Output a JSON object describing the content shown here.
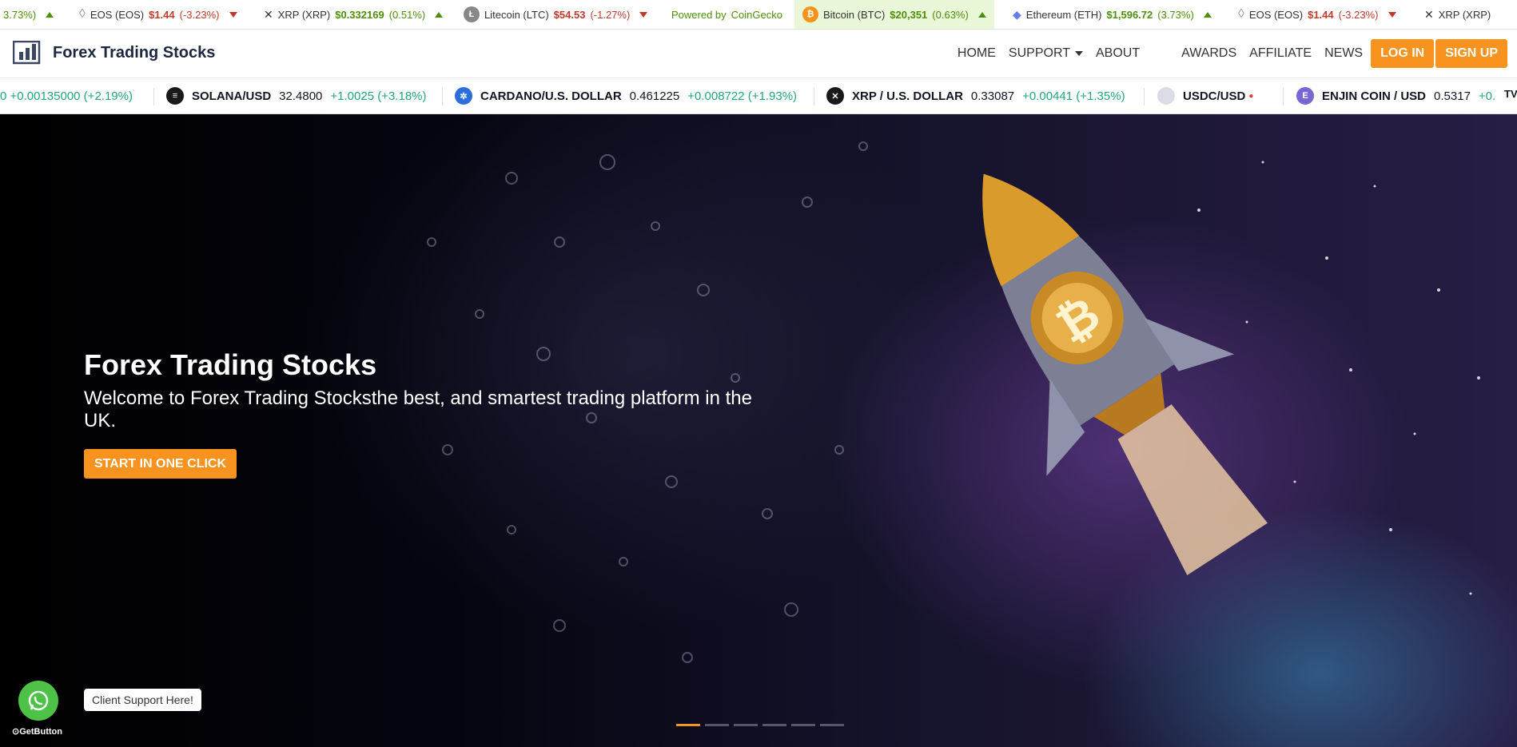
{
  "coin_ticker": {
    "items": [
      {
        "name": "",
        "price": "",
        "change": "3.73%)",
        "dir": "up",
        "icon_name": "",
        "icon_char": "",
        "icon_color": ""
      },
      {
        "name": "EOS (EOS)",
        "price": "$1.44",
        "change": "(-3.23%)",
        "dir": "down",
        "icon_name": "eos-icon",
        "icon_char": "◇",
        "icon_color": "#999999"
      },
      {
        "name": "XRP (XRP)",
        "price": "$0.332169",
        "change": "(0.51%)",
        "dir": "up",
        "icon_name": "xrp-icon",
        "icon_char": "✕",
        "icon_color": "#333333"
      },
      {
        "name": "Litecoin (LTC)",
        "price": "$54.53",
        "change": "(-1.27%)",
        "dir": "down",
        "icon_name": "litecoin-icon",
        "icon_char": "Ł",
        "icon_color": "#888888"
      },
      {
        "name": "Bitcoin (BTC)",
        "price": "$20,351",
        "change": "(0.63%)",
        "dir": "up",
        "icon_name": "bitcoin-icon",
        "icon_char": "₿",
        "icon_color": "#f7931a"
      },
      {
        "name": "Ethereum (ETH)",
        "price": "$1,596.72",
        "change": "(3.73%)",
        "dir": "up",
        "icon_name": "ethereum-icon",
        "icon_char": "◆",
        "icon_color": "#627eea"
      },
      {
        "name": "EOS (EOS)",
        "price": "$1.44",
        "change": "(-3.23%)",
        "dir": "down",
        "icon_name": "eos-icon",
        "icon_char": "◇",
        "icon_color": "#999999"
      },
      {
        "name": "XRP (XRP)",
        "price": "",
        "change": "",
        "dir": "",
        "icon_name": "xrp-icon",
        "icon_char": "✕",
        "icon_color": "#333333"
      }
    ],
    "powered_by": "Powered by",
    "powered_brand": "CoinGecko"
  },
  "navbar": {
    "brand": "Forex Trading Stocks",
    "links": [
      "HOME",
      "SUPPORT",
      "ABOUT",
      "AWARDS",
      "AFFILIATE",
      "NEWS"
    ],
    "login": "LOG IN",
    "signup": "SIGN UP"
  },
  "pair_ticker": {
    "items": [
      {
        "symbol": "",
        "value": "",
        "change": "0 +0.00135000 (+2.19%)",
        "icon_name": "",
        "icon_color": ""
      },
      {
        "symbol": "SOLANA/USD",
        "value": "32.4800",
        "change": "+1.0025 (+3.18%)",
        "icon_name": "solana-icon",
        "icon_color": "#1a1a1a"
      },
      {
        "symbol": "CARDANO/U.S. DOLLAR",
        "value": "0.461225",
        "change": "+0.008722 (+1.93%)",
        "icon_name": "cardano-icon",
        "icon_color": "#2a6fdb"
      },
      {
        "symbol": "XRP / U.S. DOLLAR",
        "value": "0.33087",
        "change": "+0.00441 (+1.35%)",
        "icon_name": "xrp-icon",
        "icon_color": "#1a1a1a"
      },
      {
        "symbol": "USDC/USD",
        "value": "",
        "change": "",
        "icon_name": "usdc-icon",
        "icon_color": "#dcdce6"
      },
      {
        "symbol": "ENJIN COIN / USD",
        "value": "0.5317",
        "change": "+0.",
        "icon_name": "enjin-icon",
        "icon_color": "#7866d5"
      }
    ]
  },
  "hero": {
    "title": "Forex Trading Stocks",
    "subtitle": "Welcome to Forex Trading Stocksthe best, and smartest trading platform in the UK.",
    "button": "START IN ONE CLICK",
    "slide_count": 6,
    "active_slide": 1
  },
  "widget": {
    "tooltip": "Client Support Here!",
    "brand": "GetButton"
  },
  "colors": {
    "accent": "#f7931e",
    "up_green": "#4d8f0a",
    "down_red": "#c0392b",
    "pair_green": "#22a67a",
    "whatsapp": "#4dc247"
  }
}
